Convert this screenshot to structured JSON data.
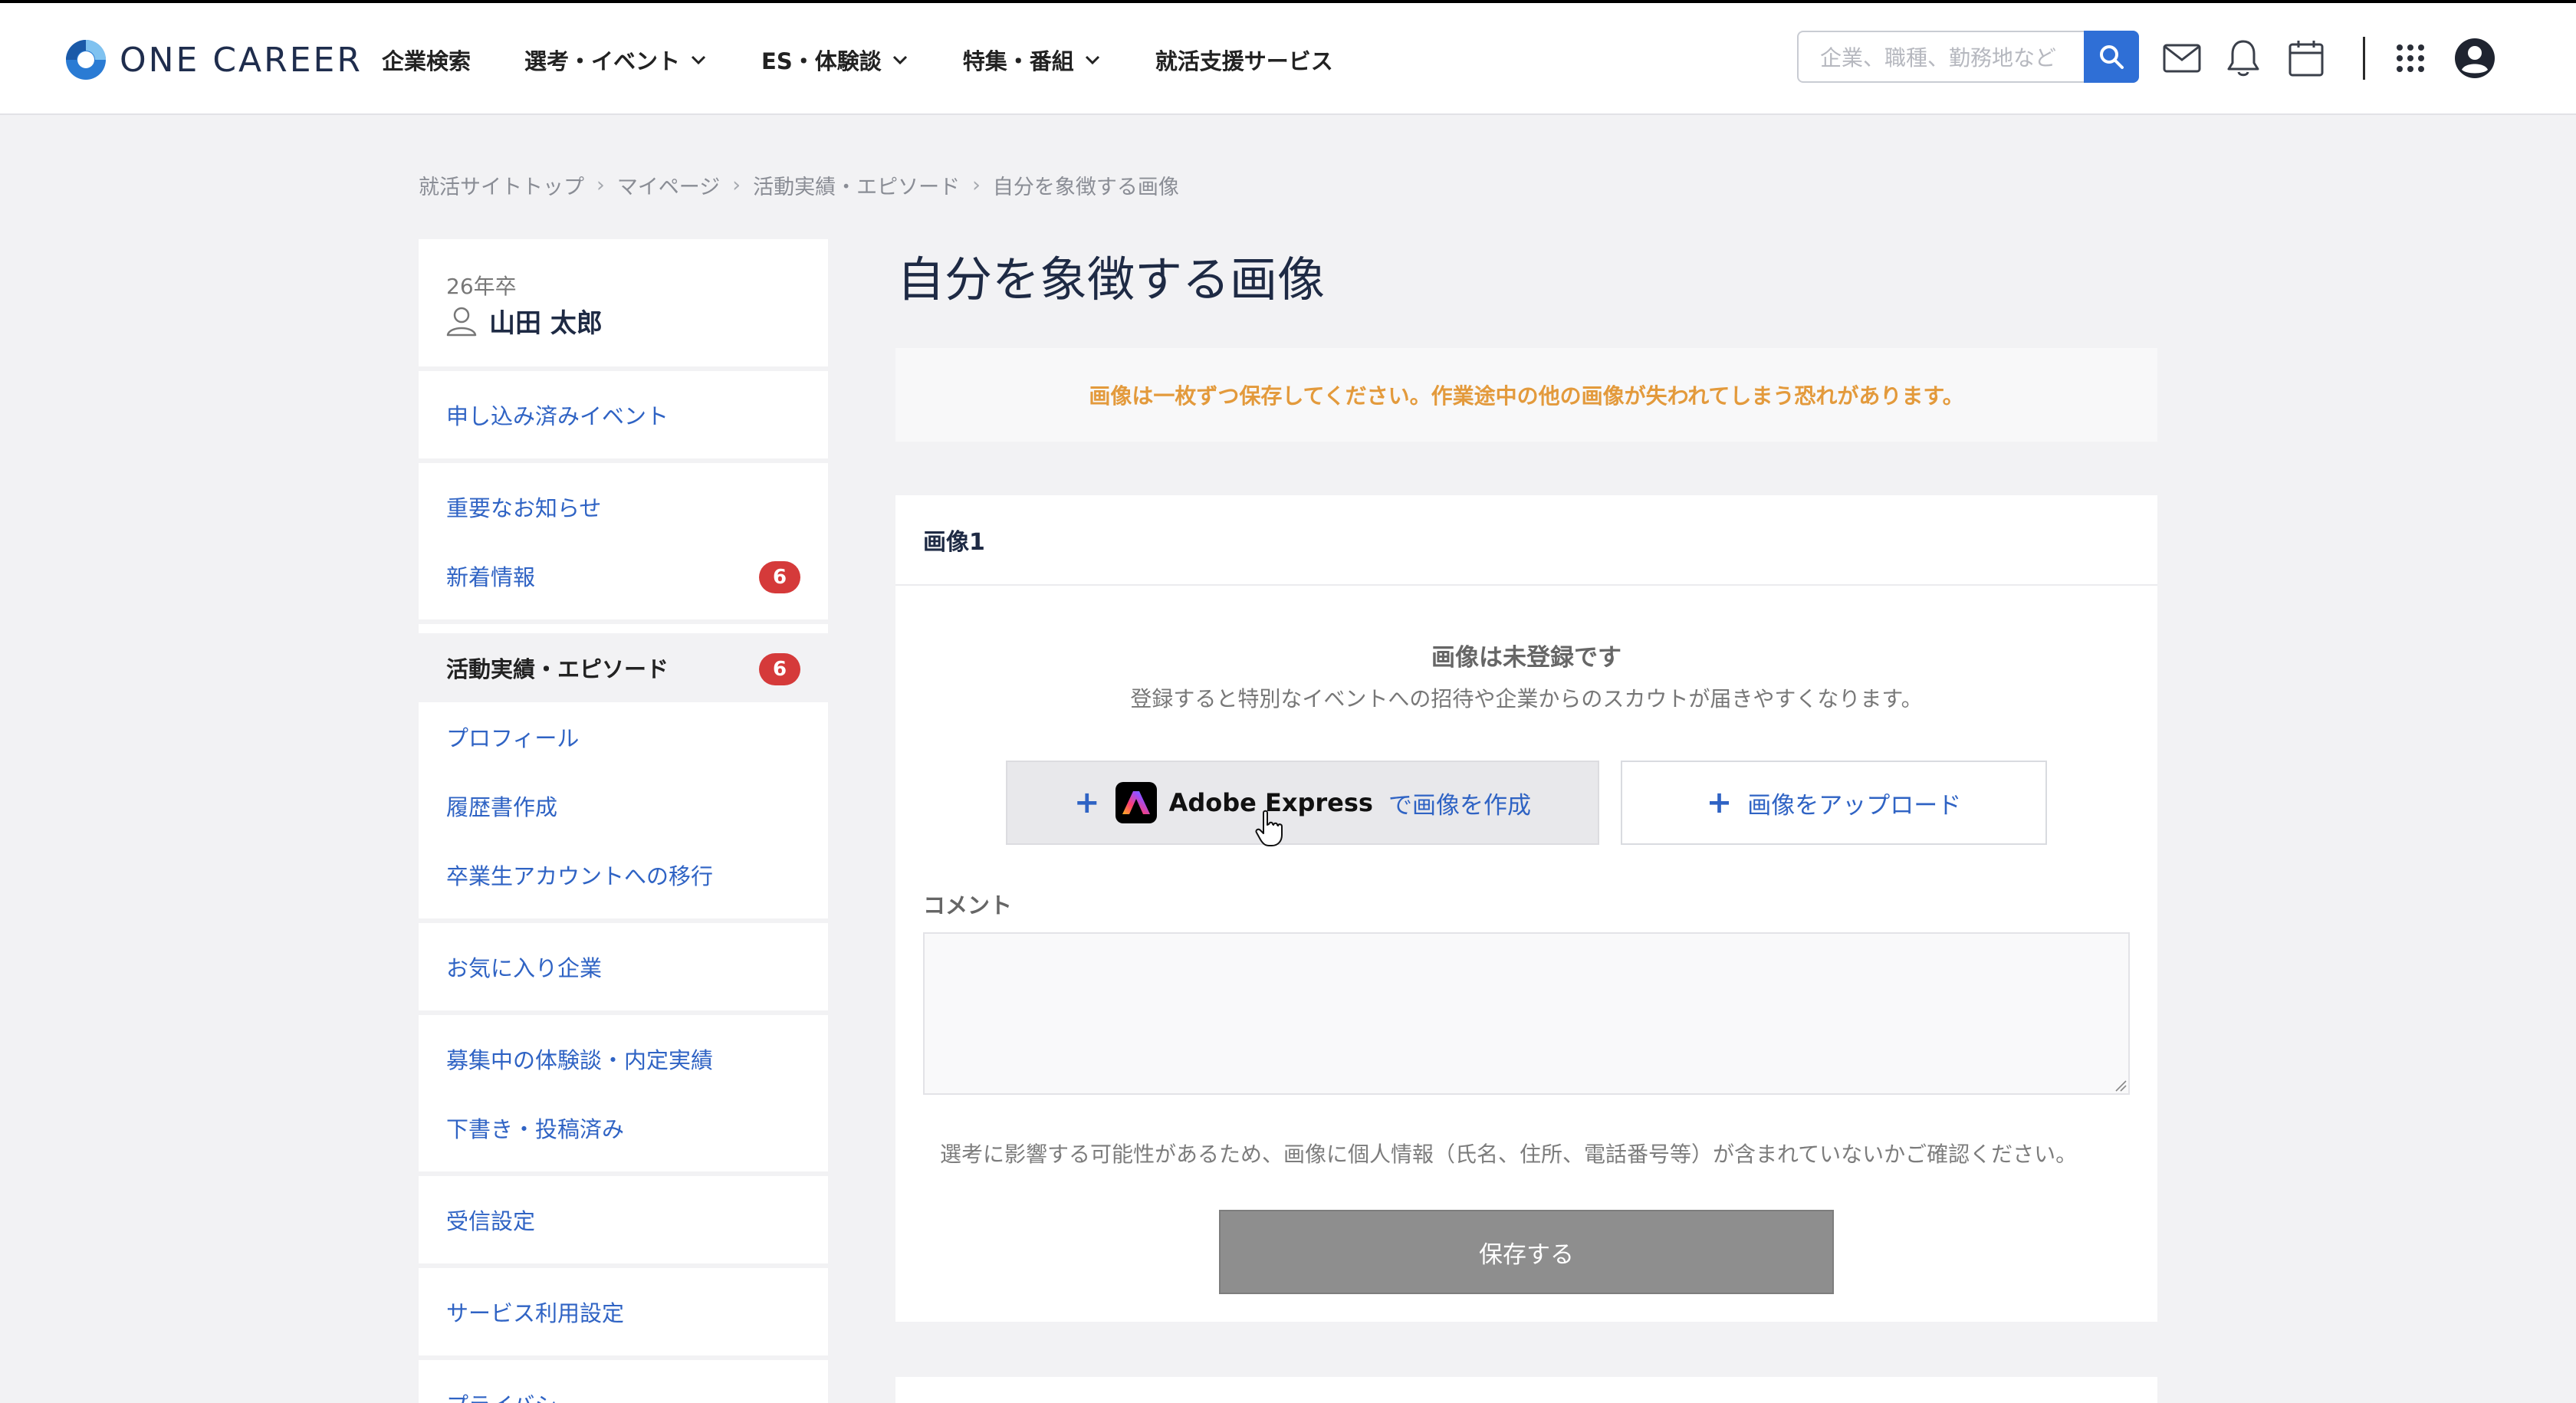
{
  "header": {
    "logo_text": "ONE CAREER",
    "nav": [
      {
        "label": "企業検索",
        "has_dropdown": false
      },
      {
        "label": "選考・イベント",
        "has_dropdown": true
      },
      {
        "label": "ES・体験談",
        "has_dropdown": true
      },
      {
        "label": "特集・番組",
        "has_dropdown": true
      },
      {
        "label": "就活支援サービス",
        "has_dropdown": false
      }
    ],
    "search_placeholder": "企業、職種、勤務地など",
    "icons": [
      "mail-icon",
      "bell-icon",
      "calendar-icon",
      "apps-grid-icon",
      "account-icon"
    ]
  },
  "breadcrumb": [
    "就活サイトトップ",
    "マイページ",
    "活動実績・エピソード",
    "自分を象徴する画像"
  ],
  "sidebar": {
    "graduation": "26年卒",
    "user_name": "山田 太郎",
    "groups": [
      [
        {
          "label": "申し込み済みイベント"
        }
      ],
      [
        {
          "label": "重要なお知らせ"
        },
        {
          "label": "新着情報",
          "badge": "6"
        }
      ],
      [
        {
          "label": "活動実績・エピソード",
          "badge": "6",
          "active": true
        },
        {
          "label": "プロフィール"
        },
        {
          "label": "履歴書作成"
        },
        {
          "label": "卒業生アカウントへの移行"
        }
      ],
      [
        {
          "label": "お気に入り企業"
        }
      ],
      [
        {
          "label": "募集中の体験談・内定実績"
        },
        {
          "label": "下書き・投稿済み"
        }
      ],
      [
        {
          "label": "受信設定"
        }
      ],
      [
        {
          "label": "サービス利用設定"
        }
      ],
      [
        {
          "label": "プライバシー"
        }
      ]
    ]
  },
  "main": {
    "title": "自分を象徴する画像",
    "notice": "画像は一枚ずつ保存してください。作業途中の他の画像が失われてしまう恐れがあります。",
    "card": {
      "title": "画像1",
      "empty_title": "画像は未登録です",
      "empty_sub": "登録すると特別なイベントへの招待や企業からのスカウトが届きやすくなります。",
      "adobe_plus": "+",
      "adobe_name": "Adobe Express",
      "adobe_action": "で画像を作成",
      "upload_plus": "+",
      "upload_label": "画像をアップロード",
      "comment_label": "コメント",
      "comment_value": "",
      "warning": "選考に影響する可能性があるため、画像に個人情報（氏名、住所、電話番号等）が含まれていないかご確認ください。",
      "save_label": "保存する"
    }
  },
  "colors": {
    "accent": "#2f63c4",
    "notice": "#e39a3c",
    "badge": "#d53a3a",
    "save_button": "#8e8e8e"
  }
}
